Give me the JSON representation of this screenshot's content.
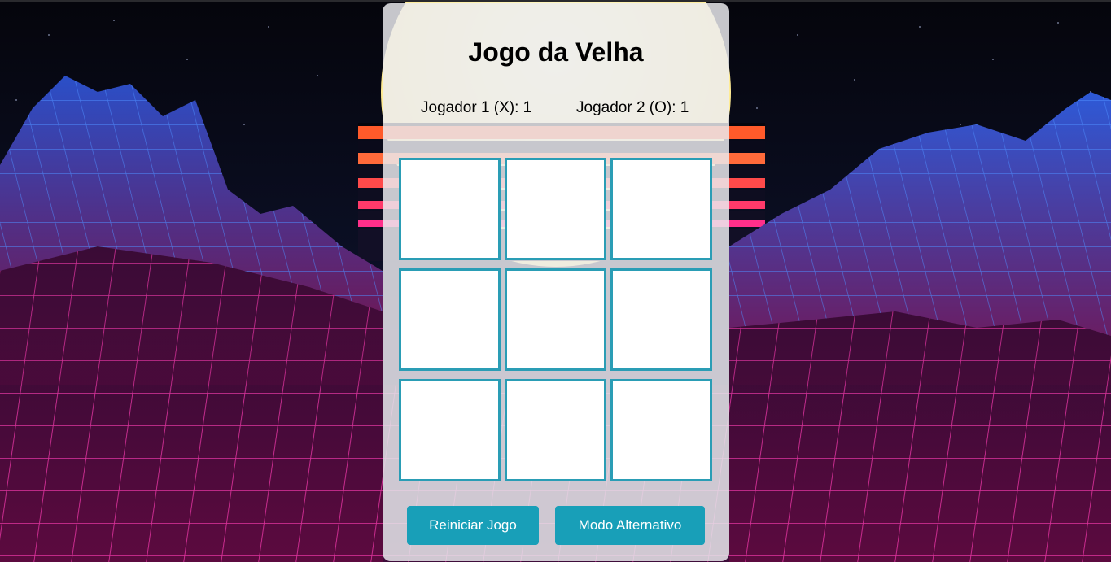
{
  "app": {
    "title": "Jogo da Velha"
  },
  "scoreboard": {
    "player1": "Jogador 1 (X): 1",
    "player2": "Jogador 2 (O): 1"
  },
  "board": {
    "cells": [
      "",
      "",
      "",
      "",
      "",
      "",
      "",
      "",
      ""
    ]
  },
  "buttons": {
    "restart_label": "Reiniciar Jogo",
    "alternate_label": "Modo Alternativo"
  },
  "colors": {
    "accent": "#189fb8",
    "cell_border": "#2a9db5",
    "panel_background": "#ececf0",
    "grid_pink": "#ff2fa8",
    "grid_blue": "#3a7bff"
  }
}
